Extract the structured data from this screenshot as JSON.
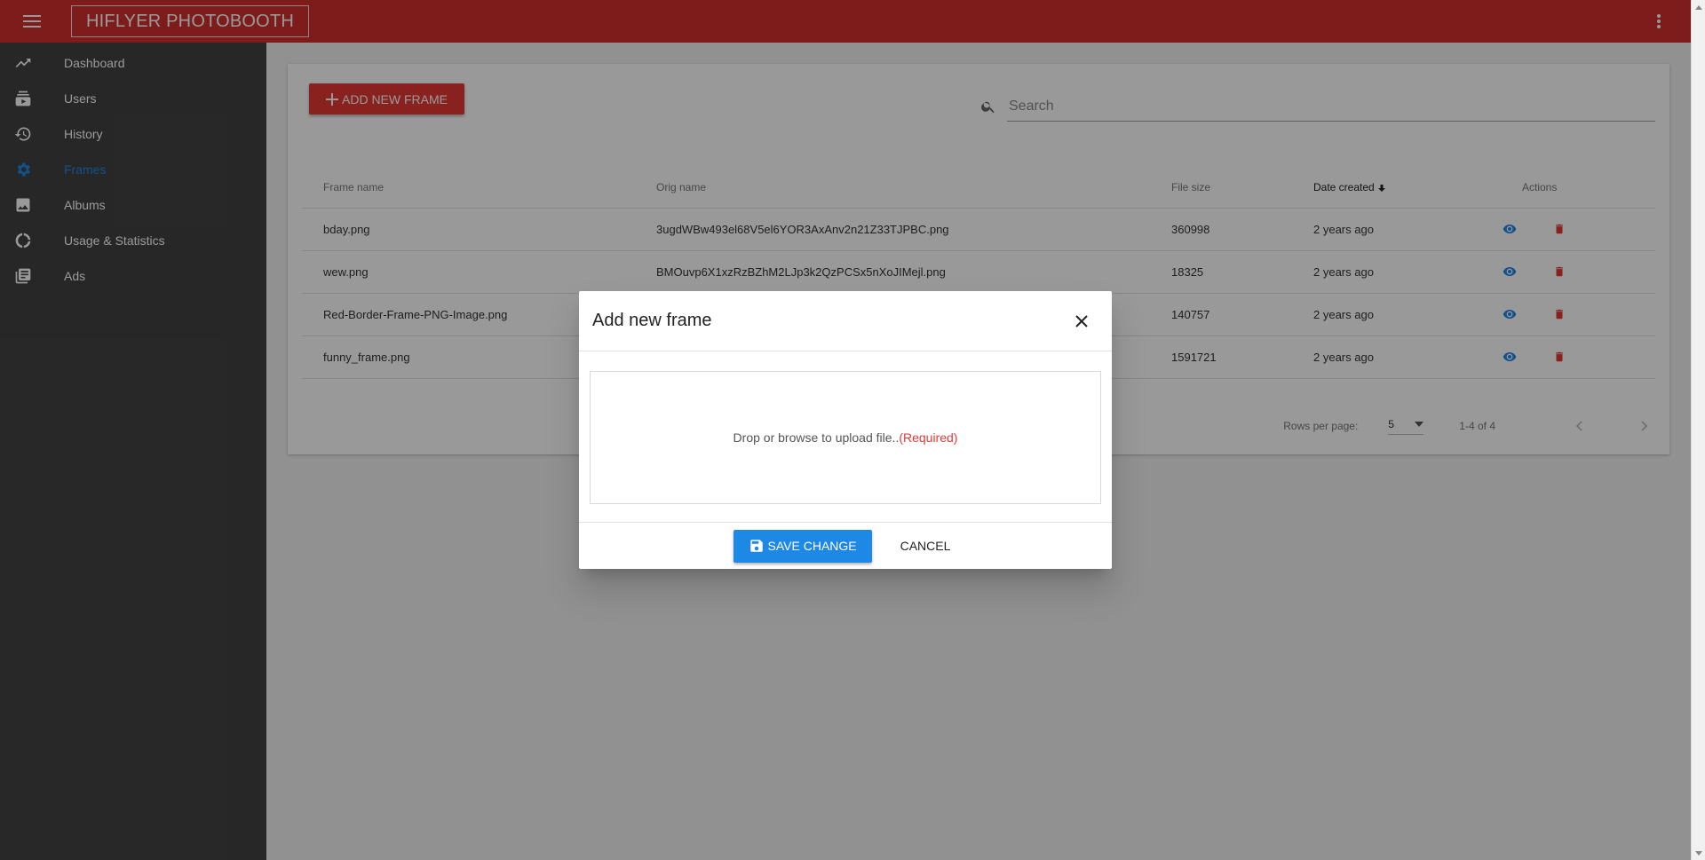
{
  "app": {
    "title": "HIFLYER PHOTOBOOTH"
  },
  "topbar": {
    "menu_icon": "menu-icon",
    "more_icon": "more-vert-icon"
  },
  "sidebar": {
    "items": [
      {
        "label": "Dashboard",
        "icon": "trending-up-icon"
      },
      {
        "label": "Users",
        "icon": "users-icon"
      },
      {
        "label": "History",
        "icon": "history-icon"
      },
      {
        "label": "Frames",
        "icon": "gear-icon",
        "active": true
      },
      {
        "label": "Albums",
        "icon": "image-icon"
      },
      {
        "label": "Usage & Statistics",
        "icon": "statistics-icon"
      },
      {
        "label": "Ads",
        "icon": "library-icon"
      }
    ]
  },
  "toolbar": {
    "add_label": "ADD NEW FRAME"
  },
  "search": {
    "placeholder": "Search",
    "value": ""
  },
  "table": {
    "headers": [
      "Frame name",
      "Orig name",
      "File size",
      "Date created",
      "Actions"
    ],
    "sorted_column": "Date created",
    "sort_direction": "descending",
    "rows": [
      {
        "frame_name": "bday.png",
        "orig_name": "3ugdWBw493el68V5el6YOR3AxAnv2n21Z33TJPBC.png",
        "file_size": "360998",
        "date_created": "2 years ago"
      },
      {
        "frame_name": "wew.png",
        "orig_name": "BMOuvp6X1xzRzBZhM2LJp3k2QzPCSx5nXoJIMejl.png",
        "file_size": "18325",
        "date_created": "2 years ago"
      },
      {
        "frame_name": "Red-Border-Frame-PNG-Image.png",
        "orig_name": "",
        "file_size": "140757",
        "date_created": "2 years ago"
      },
      {
        "frame_name": "funny_frame.png",
        "orig_name": "",
        "file_size": "1591721",
        "date_created": "2 years ago"
      }
    ]
  },
  "pagination": {
    "rows_per_page_label": "Rows per page:",
    "rows_per_page": "5",
    "range": "1-4 of 4"
  },
  "dialog": {
    "title": "Add new frame",
    "dropzone_text": "Drop or browse to upload file..",
    "required_text": "(Required)",
    "save_label": "SAVE CHANGE",
    "cancel_label": "CANCEL"
  },
  "colors": {
    "brand": "#d32f2f",
    "accent": "#1e88e5",
    "danger": "#e53935",
    "sidebar": "#424242"
  }
}
